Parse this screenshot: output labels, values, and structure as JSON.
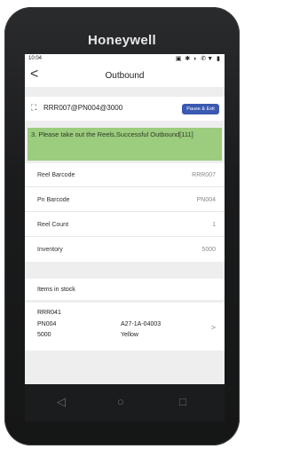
{
  "device": {
    "brand": "Honeywell"
  },
  "statusbar": {
    "time": "10:04",
    "icons": "▣ ✱ ◐ ✆▼ ▮"
  },
  "titlebar": {
    "title": "Outbound",
    "back_glyph": "<"
  },
  "scan": {
    "icon_glyph": "⛶",
    "value": "RRR007@PN004@3000",
    "pause_label": "Pause & Exit"
  },
  "message": {
    "text": "3. Please take out the Reels,Successful Outbound[111]"
  },
  "details": [
    {
      "label": "Reel Barcode",
      "value": "RRR007"
    },
    {
      "label": "Pn Barcode",
      "value": "PN004"
    },
    {
      "label": "Reel Count",
      "value": "1"
    },
    {
      "label": "Inventory",
      "value": "5000"
    }
  ],
  "stock": {
    "header": "Items in stock",
    "item": {
      "reel": "RRR041",
      "pn": "PN004",
      "qty": "5000",
      "location": "A27-1A-04003",
      "color": "Yellow",
      "chevron": ">"
    }
  },
  "navbar": {
    "back": "◁",
    "home": "○",
    "recent": "□"
  },
  "colors": {
    "accent": "#3a59b0",
    "success": "#9ccc7e"
  }
}
